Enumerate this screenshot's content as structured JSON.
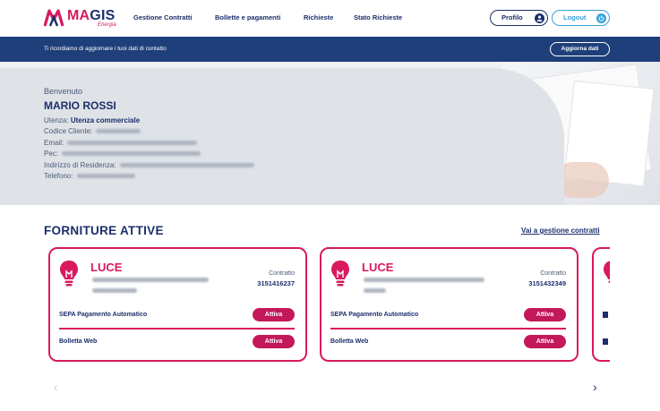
{
  "header": {
    "logo_text_ma": "MA",
    "logo_text_gis": "GIS",
    "logo_sub": "Energia",
    "nav": [
      "Gestione Contratti",
      "Bollette e pagamenti",
      "Richieste",
      "Stato Richieste"
    ],
    "profilo_label": "Profilo",
    "logout_label": "Logout"
  },
  "notice": {
    "text": "Ti ricordiamo di aggiornare i tuoi dati di contatto",
    "button": "Aggiorna dati"
  },
  "hero": {
    "greeting": "Benvenuto",
    "name": "MARIO ROSSI",
    "utenza_label": "Utenza:",
    "utenza_value": "Utenza commerciale",
    "codice_label": "Codice Cliente:",
    "email_label": "Email:",
    "pec_label": "Pec:",
    "indirizzo_label": "Indirizzo di Residenza:",
    "telefono_label": "Telefono:"
  },
  "forniture": {
    "title": "FORNITURE ATTIVE",
    "link": "Vai a gestione contratti",
    "cards": [
      {
        "type": "LUCE",
        "contratto_label": "Contratto",
        "contratto_num": "3151416237",
        "row1": "SEPA Pagamento Automatico",
        "row2": "Bolletta Web",
        "badge1": "Attiva",
        "badge2": "Attiva"
      },
      {
        "type": "LUCE",
        "contratto_label": "Contratto",
        "contratto_num": "3151432349",
        "row1": "SEPA Pagamento Automatico",
        "row2": "Bolletta Web",
        "badge1": "Attiva",
        "badge2": "Attiva"
      }
    ]
  },
  "icons": {
    "brand": "magis-logo",
    "profile": "user-icon",
    "logout": "power-icon",
    "supply": "lightbulb-icon",
    "prev": "chevron-left-icon",
    "next": "chevron-right-icon"
  },
  "colors": {
    "brand_pink": "#d9195f",
    "brand_navy": "#1b2f6b",
    "notice_bg": "#1f3f7a",
    "logout_blue": "#3aa0d8"
  },
  "carousel": {
    "prev": "‹",
    "next": "›"
  }
}
